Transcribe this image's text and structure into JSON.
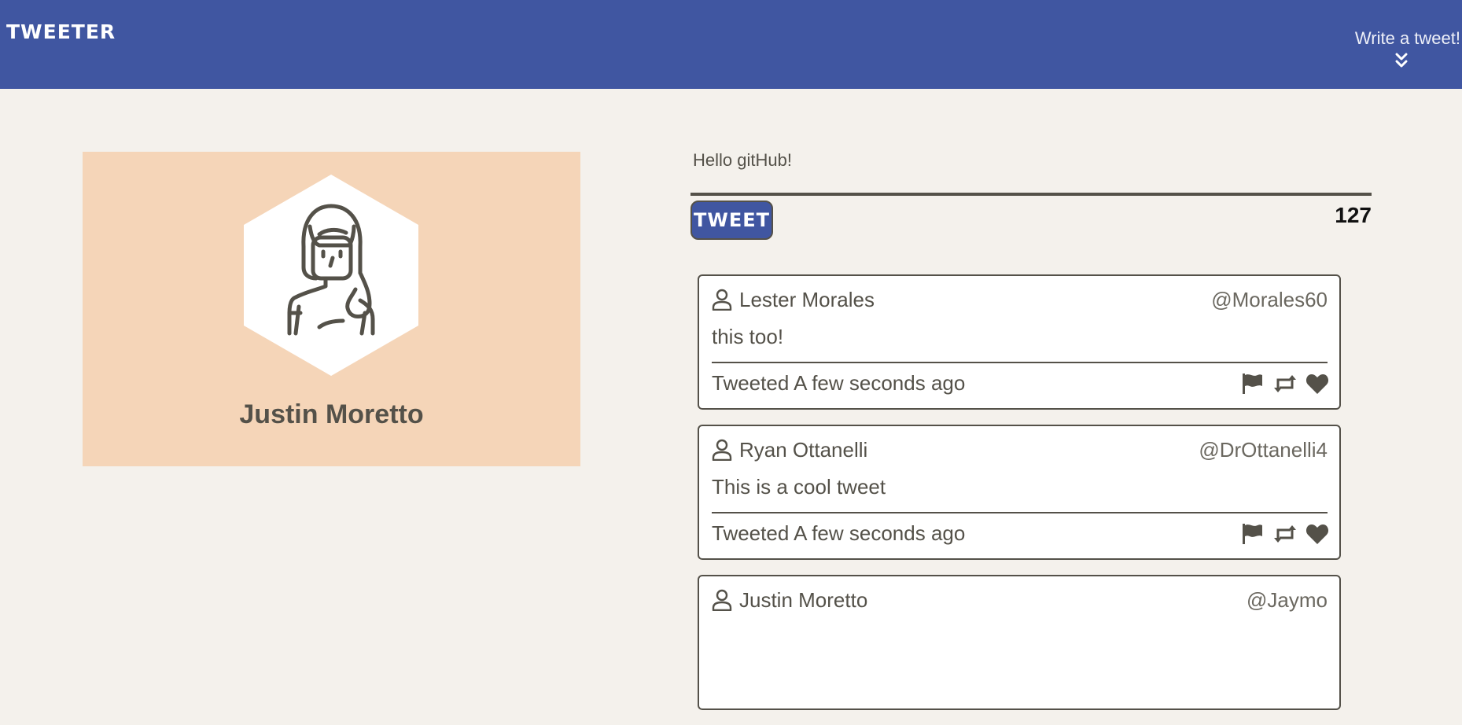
{
  "nav": {
    "brand": "TWEETER",
    "write_label": "Write a tweet!",
    "toggle_icon": "double-chevron-down-icon"
  },
  "profile": {
    "name": "Justin Moretto",
    "avatar_icon": "girl-avatar-icon"
  },
  "compose": {
    "value": "Hello gitHub!",
    "button_label": "TWEET",
    "counter": "127"
  },
  "tweets": [
    {
      "name": "Lester Morales",
      "handle": "@Morales60",
      "text": "this too!",
      "time": "Tweeted A few seconds ago"
    },
    {
      "name": "Ryan Ottanelli",
      "handle": "@DrOttanelli4",
      "text": "This is a cool tweet",
      "time": "Tweeted A few seconds ago"
    },
    {
      "name": "Justin Moretto",
      "handle": "@Jaymo",
      "text": "",
      "time": ""
    }
  ],
  "icons": {
    "user": "user-icon",
    "flag": "flag-icon",
    "retweet": "retweet-icon",
    "like": "heart-icon"
  },
  "colors": {
    "nav": "#4056a1",
    "background": "#f4f1ec",
    "profile_card": "#f5d5b8",
    "text": "#545149"
  }
}
